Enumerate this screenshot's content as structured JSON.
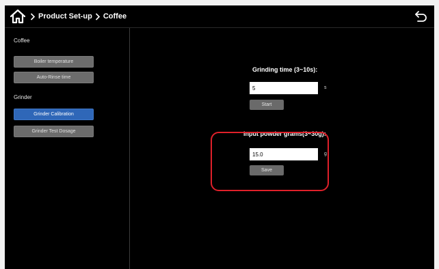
{
  "header": {
    "breadcrumb": [
      "Product Set-up",
      "Coffee"
    ],
    "home_icon": "home-icon",
    "back_icon": "back-arrow-icon",
    "separator_icon": "chevron-right-icon"
  },
  "sidebar": {
    "coffee_label": "Coffee",
    "grinder_label": "Grinder",
    "items": [
      {
        "label": "Boiler temperature",
        "active": false
      },
      {
        "label": "Auto-Rinse time",
        "active": false
      },
      {
        "label": "Grinder Calibration",
        "active": true
      },
      {
        "label": "Grinder Test Dosage",
        "active": false
      }
    ]
  },
  "main": {
    "grinding": {
      "title": "Grinding time (3~10s):",
      "value": "5",
      "unit": "s",
      "button": "Start"
    },
    "powder": {
      "title": "Input powder grams(3~30g):",
      "value": "15.0",
      "unit": "g",
      "button": "Save"
    }
  },
  "colors": {
    "active_button": "#2f67b8",
    "button": "#6c6c6c",
    "highlight": "#e0202a"
  }
}
